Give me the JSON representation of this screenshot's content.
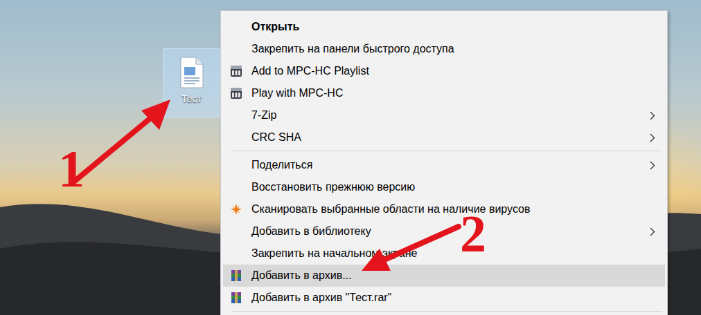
{
  "desktop_icon": {
    "label": "Тест",
    "selected": true
  },
  "context_menu": {
    "items": [
      {
        "kind": "plain",
        "label": "Открыть",
        "bold": true,
        "submenu": false,
        "selected": false
      },
      {
        "kind": "plain",
        "label": "Закрепить на панели быстрого доступа",
        "bold": false,
        "submenu": false,
        "selected": false
      },
      {
        "kind": "mpc",
        "label": "Add to MPC-HC Playlist",
        "bold": false,
        "submenu": false,
        "selected": false
      },
      {
        "kind": "mpc",
        "label": "Play with MPC-HC",
        "bold": false,
        "submenu": false,
        "selected": false
      },
      {
        "kind": "plain",
        "label": "7-Zip",
        "bold": false,
        "submenu": true,
        "selected": false
      },
      {
        "kind": "plain",
        "label": "CRC SHA",
        "bold": false,
        "submenu": true,
        "selected": false
      },
      {
        "kind": "separator",
        "label": "",
        "bold": false,
        "submenu": false,
        "selected": false
      },
      {
        "kind": "plain",
        "label": "Поделиться",
        "bold": false,
        "submenu": true,
        "selected": false
      },
      {
        "kind": "plain",
        "label": "Восстановить прежнюю версию",
        "bold": false,
        "submenu": false,
        "selected": false
      },
      {
        "kind": "scan",
        "label": "Сканировать выбранные области на наличие вирусов",
        "bold": false,
        "submenu": false,
        "selected": false
      },
      {
        "kind": "plain",
        "label": "Добавить в библиотеку",
        "bold": false,
        "submenu": true,
        "selected": false
      },
      {
        "kind": "plain",
        "label": "Закрепить на начальном экране",
        "bold": false,
        "submenu": false,
        "selected": false
      },
      {
        "kind": "rar",
        "label": "Добавить в архив...",
        "bold": false,
        "submenu": false,
        "selected": true
      },
      {
        "kind": "rar",
        "label": "Добавить в архив \"Тест.rar\"",
        "bold": false,
        "submenu": false,
        "selected": false
      },
      {
        "kind": "separator",
        "label": "",
        "bold": false,
        "submenu": false,
        "selected": false
      }
    ]
  },
  "annotations": [
    {
      "label": "1"
    },
    {
      "label": "2"
    }
  ]
}
